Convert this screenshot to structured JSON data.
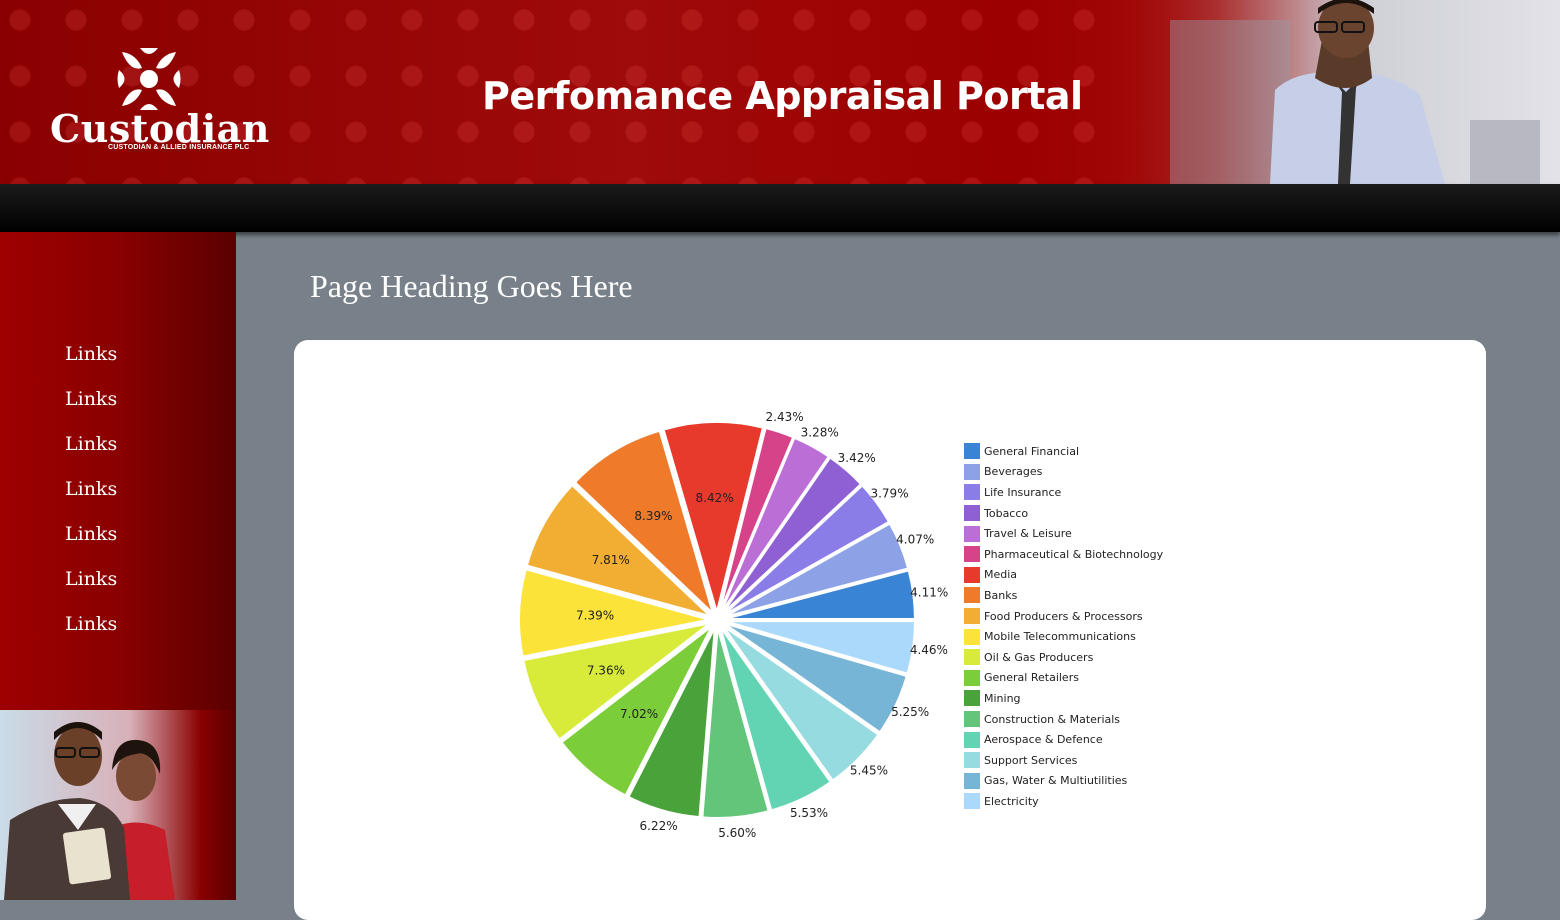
{
  "header": {
    "logo_text": "Custodian",
    "logo_subtext": "CUSTODIAN & ALLIED INSURANCE PLC",
    "title": "Perfomance Appraisal Portal"
  },
  "sidebar": {
    "links": [
      {
        "label": "Links"
      },
      {
        "label": "Links"
      },
      {
        "label": "Links"
      },
      {
        "label": "Links"
      },
      {
        "label": "Links"
      },
      {
        "label": "Links"
      },
      {
        "label": "Links"
      }
    ]
  },
  "main": {
    "page_heading": "Page Heading Goes Here"
  },
  "colors": {
    "brand_red": "#9e0000",
    "background": "#78808a"
  },
  "chart_data": {
    "type": "pie",
    "title": "",
    "legend_position": "right",
    "slices": [
      {
        "label": "General Financial",
        "value": 4.11,
        "label_text": "4.11%",
        "color": "#3a84d6"
      },
      {
        "label": "Beverages",
        "value": 4.07,
        "label_text": "4.07%",
        "color": "#8ca1e6"
      },
      {
        "label": "Life Insurance",
        "value": 3.79,
        "label_text": "3.79%",
        "color": "#8a7de8"
      },
      {
        "label": "Tobacco",
        "value": 3.42,
        "label_text": "3.42%",
        "color": "#8f5fd4"
      },
      {
        "label": "Travel & Leisure",
        "value": 3.28,
        "label_text": "3.28%",
        "color": "#bb6fd6"
      },
      {
        "label": "Pharmaceutical & Biotechnology",
        "value": 2.43,
        "label_text": "2.43%",
        "color": "#d64388"
      },
      {
        "label": "Media",
        "value": 8.42,
        "label_text": "8.42%",
        "color": "#e8392d"
      },
      {
        "label": "Banks",
        "value": 8.39,
        "label_text": "8.39%",
        "color": "#ee7a2a"
      },
      {
        "label": "Food Producers & Processors",
        "value": 7.81,
        "label_text": "7.81%",
        "color": "#f2ad33"
      },
      {
        "label": "Mobile Telecommunications",
        "value": 7.39,
        "label_text": "7.39%",
        "color": "#fbe33a"
      },
      {
        "label": "Oil & Gas Producers",
        "value": 7.36,
        "label_text": "7.36%",
        "color": "#d9eb3a"
      },
      {
        "label": "General Retailers",
        "value": 7.02,
        "label_text": "7.02%",
        "color": "#7ccd3a"
      },
      {
        "label": "Mining",
        "value": 6.22,
        "label_text": "6.22%",
        "color": "#4aa33a"
      },
      {
        "label": "Construction & Materials",
        "value": 5.6,
        "label_text": "5.60%",
        "color": "#62c57a"
      },
      {
        "label": "Aerospace & Defence",
        "value": 5.53,
        "label_text": "5.53%",
        "color": "#62d3b3"
      },
      {
        "label": "Support Services",
        "value": 5.45,
        "label_text": "5.45%",
        "color": "#95dbe0"
      },
      {
        "label": "Gas, Water & Multiutilities",
        "value": 5.25,
        "label_text": "5.25%",
        "color": "#77b5d6"
      },
      {
        "label": "Electricity",
        "value": 4.46,
        "label_text": "4.46%",
        "color": "#aad9fb"
      }
    ]
  }
}
